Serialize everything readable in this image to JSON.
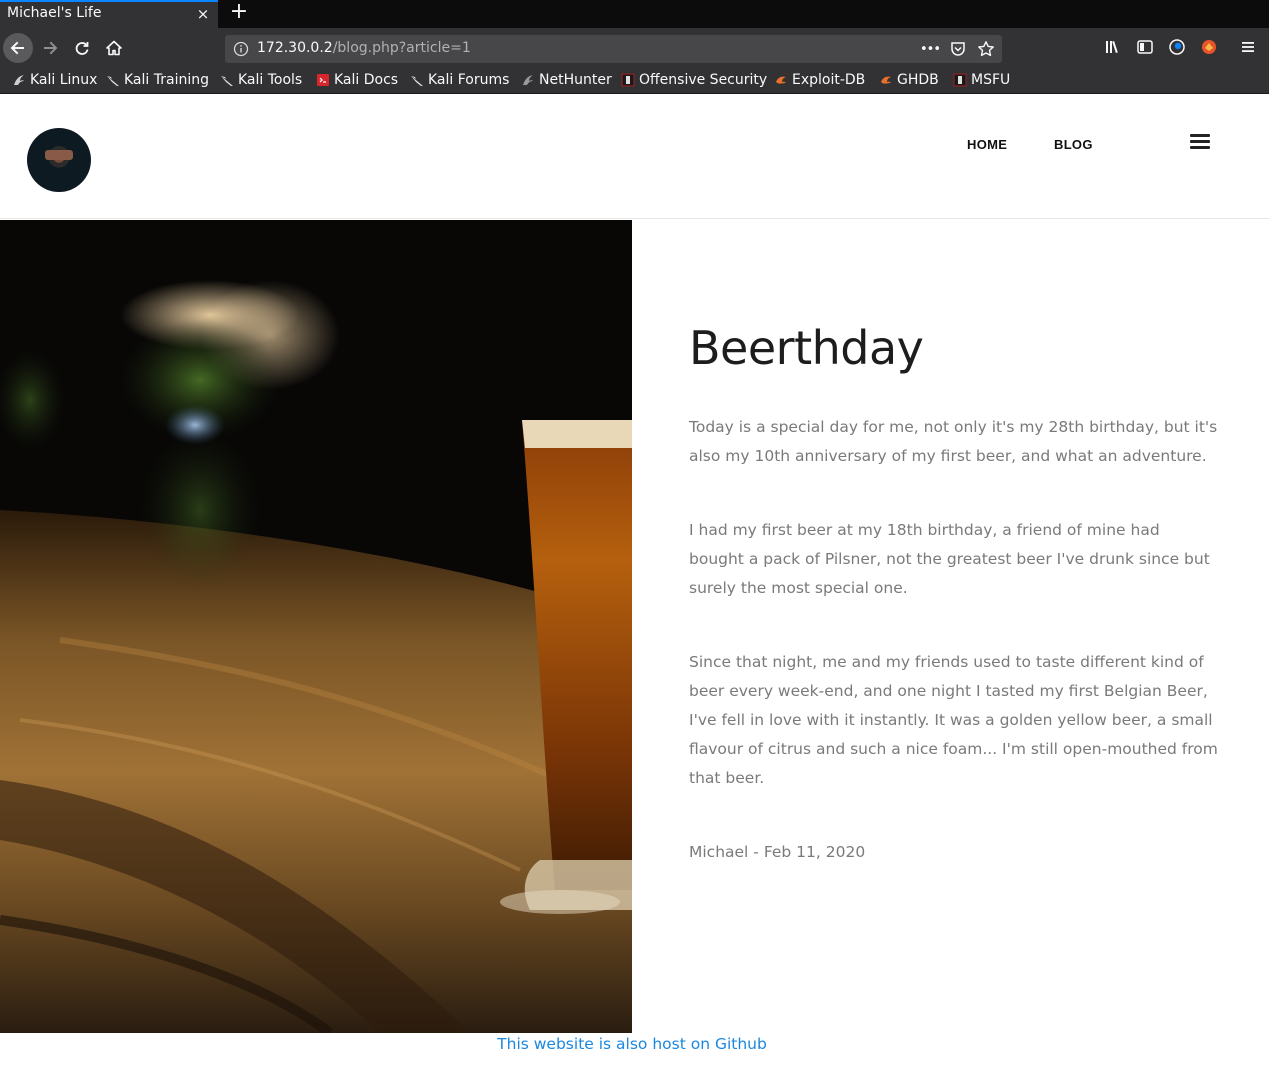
{
  "browser": {
    "tab_title": "Michael's Life",
    "tab_close": "×",
    "new_tab": "+",
    "url_host": "172.30.0.2",
    "url_path": "/blog.php?article=1",
    "url_actions_more": "•••",
    "bookmarks": [
      {
        "label": "Kali Linux",
        "icon": "kali-dragon-icon"
      },
      {
        "label": "Kali Training",
        "icon": "kali-dragon-icon"
      },
      {
        "label": "Kali Tools",
        "icon": "kali-dragon-icon"
      },
      {
        "label": "Kali Docs",
        "icon": "kali-docs-icon"
      },
      {
        "label": "Kali Forums",
        "icon": "kali-dragon-icon"
      },
      {
        "label": "NetHunter",
        "icon": "nethunter-icon"
      },
      {
        "label": "Offensive Security",
        "icon": "offsec-icon"
      },
      {
        "label": "Exploit-DB",
        "icon": "exploitdb-icon"
      },
      {
        "label": "GHDB",
        "icon": "exploitdb-icon"
      },
      {
        "label": "MSFU",
        "icon": "offsec-icon"
      }
    ]
  },
  "site": {
    "nav": {
      "home": "HOME",
      "blog": "BLOG"
    }
  },
  "article": {
    "title": "Beerthday",
    "paragraphs": [
      "Today is a special day for me, not only it's my 28th birthday, but it's also my 10th anniversary of my first beer, and what an adventure.",
      "I had my first beer at my 18th birthday, a friend of mine had bought a pack of Pilsner, not the greatest beer I've drunk since but surely the most special one.",
      "Since that night, me and my friends used to taste different kind of beer every week-end, and one night I tasted my first Belgian Beer, I've fell in love with it instantly. It was a golden yellow beer, a small flavour of citrus and such a nice foam... I'm still open-mouthed from that beer."
    ],
    "author_line": "Michael - Feb 11, 2020"
  },
  "footer": {
    "link_text": "This website is also host on Github"
  },
  "colors": {
    "accent_link": "#1a88e0",
    "chrome_bg": "#323234",
    "focus_tab": "#0a84ff"
  }
}
